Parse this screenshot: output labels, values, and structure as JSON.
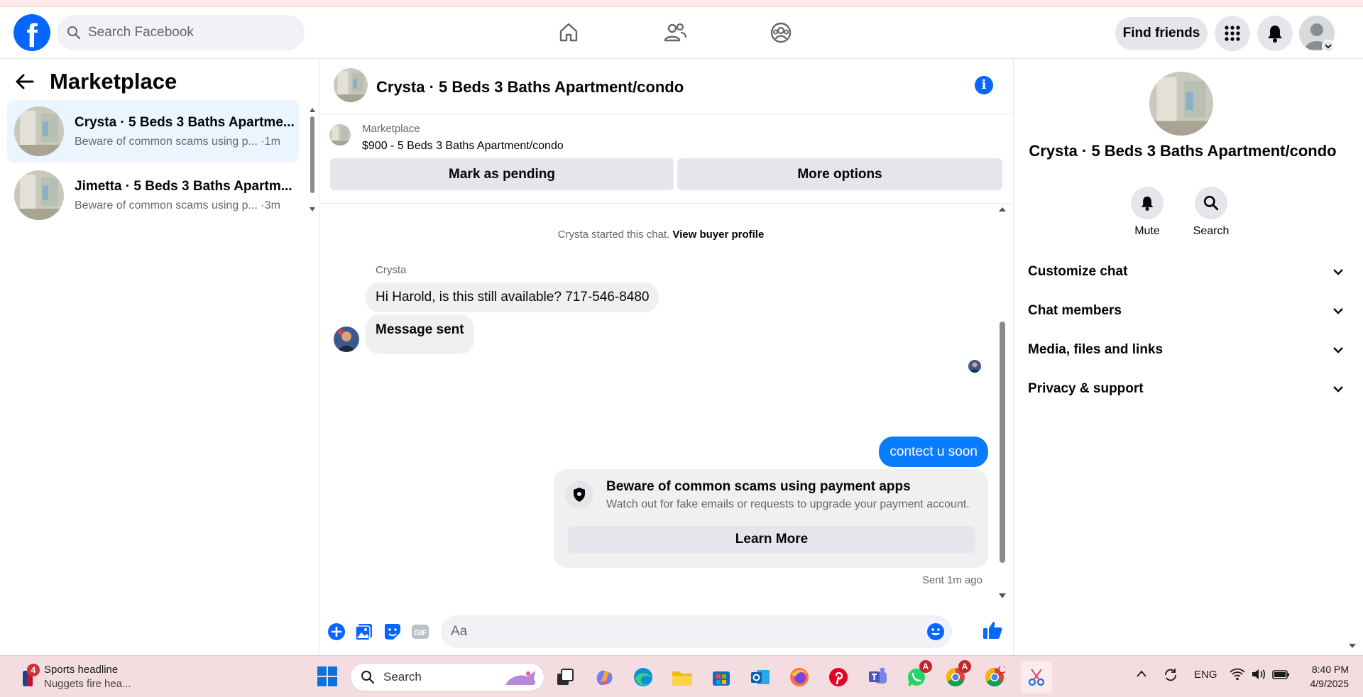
{
  "topbar": {
    "logo": "f",
    "search_placeholder": "Search Facebook",
    "nav_icons": [
      "home-icon",
      "friends-icon",
      "groups-icon"
    ],
    "find_friends": "Find friends",
    "menu_icon": "grid-menu-icon",
    "notifications_icon": "bell-icon",
    "brand_color": "#0866ff"
  },
  "sidebar": {
    "title": "Marketplace",
    "conversations": [
      {
        "name": "Crysta · 5 Beds 3 Baths Apartme...",
        "preview": "Beware of common scams using p...",
        "time": "·1m",
        "active": true
      },
      {
        "name": "Jimetta · 5 Beds 3 Baths Apartm...",
        "preview": "Beware of common scams using p...",
        "time": "·3m",
        "active": false
      }
    ]
  },
  "chat": {
    "title": "Crysta · 5 Beds 3 Baths Apartment/condo",
    "marketplace_label": "Marketplace",
    "listing": "$900 - 5 Beds 3 Baths Apartment/condo",
    "mark_pending": "Mark as pending",
    "more_options": "More options",
    "started_text": "Crysta started this chat.",
    "view_profile": "View buyer profile",
    "sender": "Crysta",
    "incoming": [
      "Hi Harold, is this still available? 717-546-8480",
      "Message sent"
    ],
    "outgoing": "contect u soon",
    "scam_title": "Beware of common scams using payment apps",
    "scam_sub": "Watch out for fake emails or requests to upgrade your payment account.",
    "learn_more": "Learn More",
    "sent_time": "Sent 1m ago",
    "composer_placeholder": "Aa",
    "outgoing_color": "#0a7cff"
  },
  "details": {
    "name": "Crysta · 5 Beds 3 Baths Apartment/condo",
    "mute": "Mute",
    "search": "Search",
    "sections": [
      "Customize chat",
      "Chat members",
      "Media, files and links",
      "Privacy & support"
    ]
  },
  "taskbar": {
    "news_badge": "4",
    "news_title": "Sports headline",
    "news_sub": "Nuggets fire hea...",
    "search": "Search",
    "lang": "ENG",
    "time": "8:40 PM",
    "date": "4/9/2025",
    "badge_a1": "A",
    "badge_a2": "A"
  }
}
